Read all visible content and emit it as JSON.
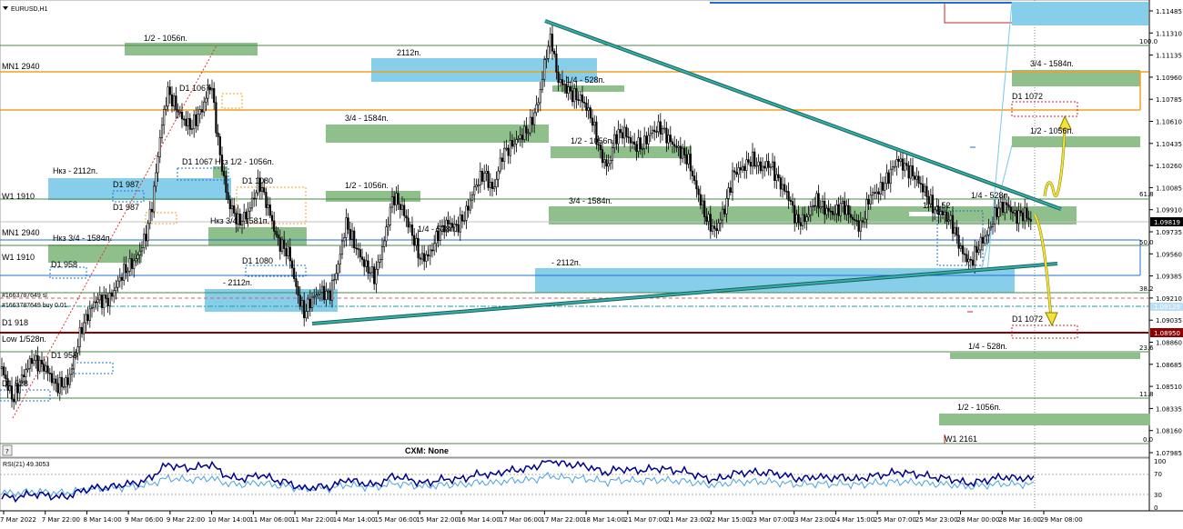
{
  "window": {
    "title": "EURUSD,H1",
    "menu_icon": "triangle-down-icon"
  },
  "price_axis": {
    "ticks": [
      "1.11485",
      "1.11310",
      "1.11135",
      "1.10960",
      "1.10785",
      "1.10610",
      "1.10435",
      "1.10260",
      "1.10085",
      "1.09910",
      "1.09735",
      "1.09560",
      "1.09385",
      "1.09210",
      "1.09035",
      "1.08860",
      "1.08685",
      "1.08510",
      "1.08335",
      "1.08160",
      "1.07985"
    ],
    "current_price": "1.09819",
    "marker_high": "1.09129",
    "marker_low": "1.08950"
  },
  "time_axis": {
    "labels": [
      "7 Mar 2022",
      "7 Mar 22:00",
      "8 Mar 14:00",
      "9 Mar 06:00",
      "9 Mar 22:00",
      "10 Mar 14:00",
      "11 Mar 06:00",
      "11 Mar 22:00",
      "14 Mar 14:00",
      "15 Mar 06:00",
      "15 Mar 22:00",
      "16 Mar 14:00",
      "17 Mar 06:00",
      "17 Mar 22:00",
      "18 Mar 14:00",
      "21 Mar 07:00",
      "21 Mar 23:00",
      "22 Mar 15:00",
      "23 Mar 07:00",
      "23 Mar 23:00",
      "24 Mar 15:00",
      "25 Mar 07:00",
      "25 Mar 23:00",
      "28 Mar 00:00",
      "28 Mar 16:00",
      "29 Mar 08:00"
    ]
  },
  "fib_levels": [
    "100.0",
    "61.8",
    "50.0",
    "38.2",
    "23.6",
    "11.8",
    "0.0"
  ],
  "chart_labels": {
    "half_1056_top": "1/2 - 1056п.",
    "mn1_top": "MN1 2940",
    "d1_1067_a": "D1 1067",
    "d1_1067_b": "D1 1067",
    "nkz_half": "Нкз 1/2 - 1056п.",
    "nkz_2112": "Нкз - 2112п.",
    "d1_987_a": "D1 987",
    "d1_987_b": "D1 987",
    "w1_1910_top": "W1 1910",
    "d1_1080_a": "D1 1080",
    "nkz_3q_1581": "Нкз 3/4 - 1581п.",
    "mn1_bottom": "MN1 2940",
    "nkz_3q_1584": "Нкз 3/4 - 1584п.",
    "w1_1910_bottom": "W1 1910",
    "d1_958_a": "D1 958",
    "d1_1080_b": "D1 1080",
    "minus_2112_left": "- 2112п.",
    "order_sell": "#1663787649 sl",
    "order_buy": "#1663787649 buy 0.01",
    "d1_918": "D1 918",
    "low_1528": "Low 1/528п.",
    "d1_958_b": "D1 958",
    "d1_528": "D1 528",
    "top_2112": "2112п.",
    "three_q_1584_a": "3/4 - 1584п.",
    "half_1056_mid": "1/2 - 1056п.",
    "quarter_528_mid": "1/4 - 528п.",
    "quarter_528_top": "1/4 - 528п.",
    "half_1056_center": "1/2 - 1056п.",
    "three_q_1584_center": "3/4 - 1584п.",
    "minus_2112_center": "- 2112п.",
    "quarter_528_right": "1/4 - 528п.",
    "quarter_52_right": "1/4 - 52",
    "three_q_1584_right": "3/4 - 1584п.",
    "d1_1072_top": "D1 1072",
    "half_1056_right": "1/2 - 1056п.",
    "d1_1072_bottom": "D1 1072",
    "quarter_528_bottom": "1/4 - 528п.",
    "half_1056_bottom": "1/2 - 1056п.",
    "w1_2161": "W1 2161",
    "cxm": "CXM: None"
  },
  "rsi": {
    "title": "RSI(21) 49.3053",
    "levels": [
      "100",
      "70",
      "30",
      "0"
    ]
  },
  "colors": {
    "green_zone": "#8fbf8a",
    "blue_zone": "#87ceeb",
    "orange_line": "#f0a020",
    "trend_line": "#2a9a94",
    "dark_red_line": "#8b0000",
    "candle": "#000000",
    "rsi_main": "#00008b",
    "rsi_signal": "#4aa3df",
    "arrow": "#f2e23a"
  }
}
